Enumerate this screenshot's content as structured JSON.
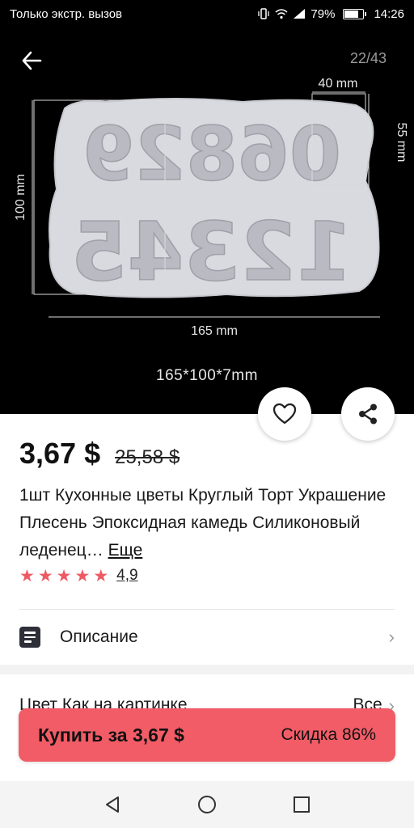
{
  "status_bar": {
    "carrier": "Только экстр. вызов",
    "battery": "79%",
    "battery_level": 0.79,
    "time": "14:26"
  },
  "gallery": {
    "counter": "22/43",
    "dim_width_top": "40 mm",
    "dim_height_right": "55 mm",
    "dim_height_left": "100 mm",
    "dim_width_bottom": "165 mm",
    "digits_top": "06829",
    "digits_bottom": "12345",
    "size_caption": "165*100*7mm"
  },
  "product": {
    "price": "3,67 $",
    "old_price": "25,58 $",
    "title": "1шт Кухонные цветы Круглый Торт Украшение Плесень Эпоксидная камедь Силиконовый леденец…",
    "more_label": "Еще",
    "rating": "4,9",
    "stars": 5
  },
  "description": {
    "label": "Описание"
  },
  "option": {
    "label": "Цвет Как на картинке",
    "value": "Все"
  },
  "buy": {
    "label": "Купить за 3,67 $",
    "discount": "Скидка 86%"
  },
  "colors": {
    "accent": "#f15c66",
    "star": "#ee5a64"
  }
}
